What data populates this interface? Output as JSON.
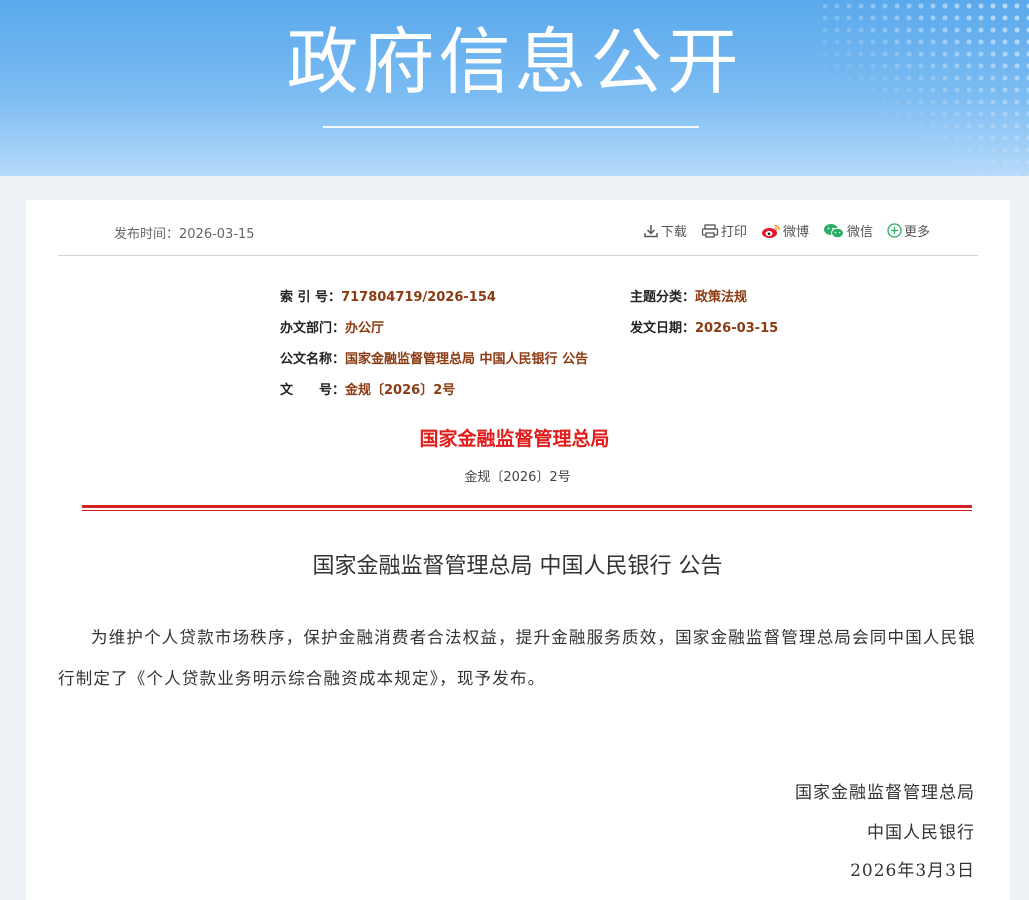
{
  "banner": {
    "title": "政府信息公开"
  },
  "meta": {
    "publish_time": "发布时间：2026-03-15",
    "tools": {
      "download": "下载",
      "print": "打印",
      "weibo": "微博",
      "wechat": "微信",
      "more": "更多"
    }
  },
  "info": {
    "index_label": "索 引 号：",
    "index_value": "717804719/2026-154",
    "category_label": "主题分类：",
    "category_value": "政策法规",
    "dept_label": "办文部门：",
    "dept_value": "办公厅",
    "date_label": "发文日期：",
    "date_value": "2026-03-15",
    "name_label": "公文名称：",
    "name_value": "国家金融监督管理总局 中国人民银行 公告",
    "docno_label": "文　　号：",
    "docno_value": "金规〔2026〕2号"
  },
  "header": {
    "org": "国家金融监督管理总局",
    "doc_number": "金规〔2026〕2号"
  },
  "document": {
    "title": "国家金融监督管理总局 中国人民银行 公告",
    "body": "为维护个人贷款市场秩序，保护金融消费者合法权益，提升金融服务质效，国家金融监督管理总局会同中国人民银行制定了《个人贷款业务明示综合融资成本规定》，现予发布。",
    "signature_1": "国家金融监督管理总局",
    "signature_2": "中国人民银行",
    "signature_date": "2026年3月3日"
  },
  "colors": {
    "banner": "#5aa9ec",
    "accent_red": "#d61f1f",
    "info_value": "#8b3a12"
  }
}
